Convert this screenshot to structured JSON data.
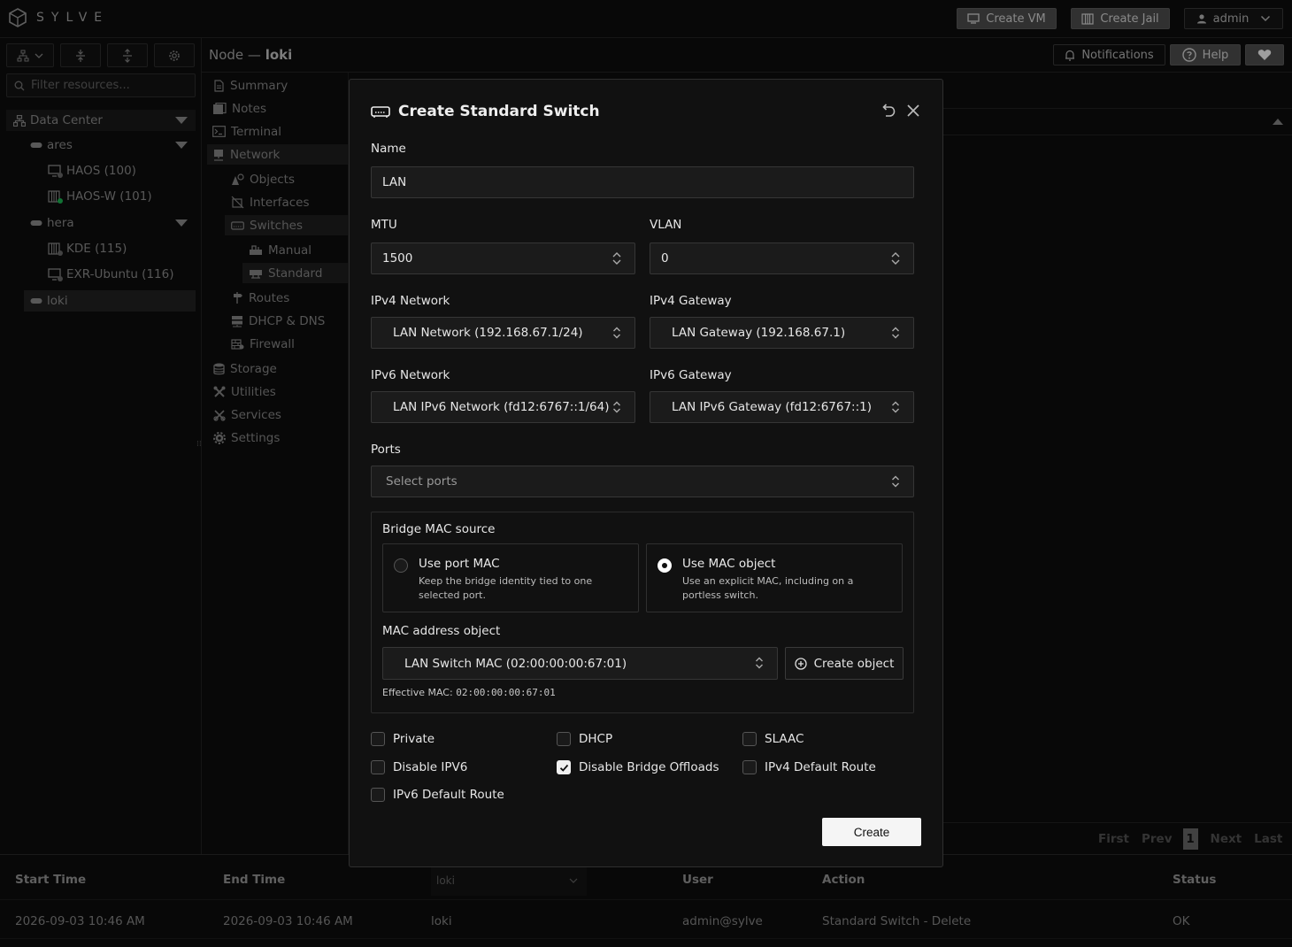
{
  "app": {
    "logo_text": "SYLVE"
  },
  "topbar": {
    "create_vm": "Create VM",
    "create_jail": "Create Jail",
    "user": "admin"
  },
  "sidebar": {
    "filter_placeholder": "Filter resources...",
    "tree": {
      "datacenter": "Data Center",
      "nodes": [
        {
          "name": "ares",
          "children": [
            "HAOS (100)",
            "HAOS-W (101)"
          ]
        },
        {
          "name": "hera",
          "children": [
            "KDE (115)",
            "EXR-Ubuntu (116)"
          ]
        },
        {
          "name": "loki",
          "children": []
        }
      ],
      "status_colors": {
        "stopped": "#6b6b6b",
        "running": "#1db954"
      }
    }
  },
  "node_header": {
    "prefix": "Node —",
    "name": "loki",
    "notifications": "Notifications",
    "help": "Help"
  },
  "menu": {
    "summary": "Summary",
    "notes": "Notes",
    "terminal": "Terminal",
    "network": "Network",
    "objects": "Objects",
    "interfaces": "Interfaces",
    "switches": "Switches",
    "manual": "Manual",
    "standard": "Standard",
    "routes": "Routes",
    "dhcp_dns": "DHCP & DNS",
    "firewall": "Firewall",
    "storage": "Storage",
    "utilities": "Utilities",
    "services": "Services",
    "settings": "Settings"
  },
  "pager": {
    "first": "First",
    "prev": "Prev",
    "page": "1",
    "next": "Next",
    "last": "Last"
  },
  "audit_table": {
    "columns": [
      "Start Time",
      "End Time",
      "User",
      "Action",
      "Status"
    ],
    "node_filter": "loki",
    "rows": [
      {
        "start": "2026-09-03 10:46 AM",
        "end": "2026-09-03 10:46 AM",
        "node": "loki",
        "user": "admin@sylve",
        "action": "Standard Switch - Delete",
        "status": "OK"
      }
    ]
  },
  "modal": {
    "title": "Create Standard Switch",
    "name_label": "Name",
    "name_value": "LAN",
    "mtu_label": "MTU",
    "mtu_value": "1500",
    "vlan_label": "VLAN",
    "vlan_value": "0",
    "ipv4_network_label": "IPv4 Network",
    "ipv4_network_value": "LAN Network (192.168.67.1/24)",
    "ipv4_gateway_label": "IPv4 Gateway",
    "ipv4_gateway_value": "LAN Gateway (192.168.67.1)",
    "ipv6_network_label": "IPv6 Network",
    "ipv6_network_value": "LAN IPv6 Network (fd12:6767::1/64)",
    "ipv6_gateway_label": "IPv6 Gateway",
    "ipv6_gateway_value": "LAN IPv6 Gateway (fd12:6767::1)",
    "ports_label": "Ports",
    "ports_placeholder": "Select ports",
    "bridge_mac_label": "Bridge MAC source",
    "option_port_mac_title": "Use port MAC",
    "option_port_mac_desc": "Keep the bridge identity tied to one selected port.",
    "option_mac_object_title": "Use MAC object",
    "option_mac_object_desc": "Use an explicit MAC, including on a portless switch.",
    "selected_mac_source": "Use MAC object",
    "mac_object_label": "MAC address object",
    "mac_object_value": "LAN Switch MAC (02:00:00:00:67:01)",
    "create_object": "Create object",
    "effective_mac_label": "Effective MAC:",
    "effective_mac_value": "02:00:00:00:67:01",
    "checkboxes": {
      "private": {
        "label": "Private",
        "checked": false
      },
      "dhcp": {
        "label": "DHCP",
        "checked": false
      },
      "slaac": {
        "label": "SLAAC",
        "checked": false
      },
      "disable_ipv6": {
        "label": "Disable IPV6",
        "checked": false
      },
      "disable_bridge_offloads": {
        "label": "Disable Bridge Offloads",
        "checked": true
      },
      "ipv4_default_route": {
        "label": "IPv4 Default Route",
        "checked": false
      },
      "ipv6_default_route": {
        "label": "IPv6 Default Route",
        "checked": false
      }
    },
    "create_button": "Create"
  }
}
